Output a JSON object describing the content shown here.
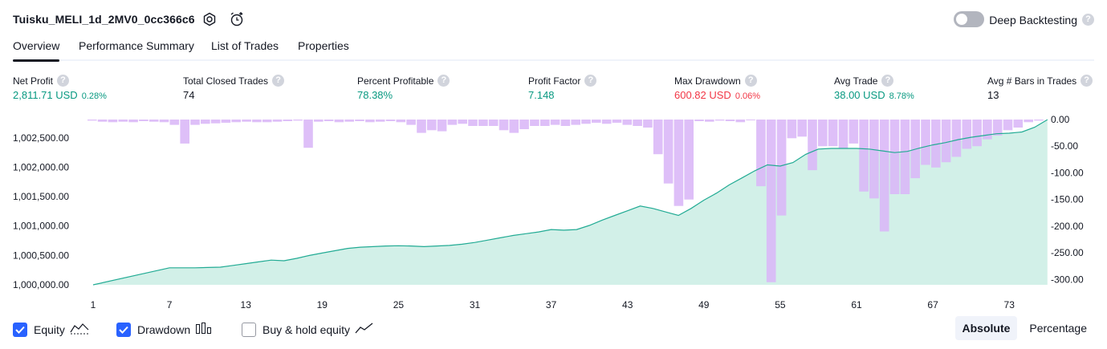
{
  "header": {
    "title": "Tuisku_MELI_1d_2MV0_0cc366c6",
    "deep_backtesting_label": "Deep Backtesting",
    "help_glyph": "?"
  },
  "tabs": [
    "Overview",
    "Performance Summary",
    "List of Trades",
    "Properties"
  ],
  "metrics": [
    {
      "label": "Net Profit",
      "value": "2,811.71 USD",
      "pct": "0.28%",
      "color": "green"
    },
    {
      "label": "Total Closed Trades",
      "value": "74",
      "pct": "",
      "color": "default"
    },
    {
      "label": "Percent Profitable",
      "value": "78.38%",
      "pct": "",
      "color": "green"
    },
    {
      "label": "Profit Factor",
      "value": "7.148",
      "pct": "",
      "color": "green"
    },
    {
      "label": "Max Drawdown",
      "value": "600.82 USD",
      "pct": "0.06%",
      "color": "red"
    },
    {
      "label": "Avg Trade",
      "value": "38.00 USD",
      "pct": "8.78%",
      "color": "green"
    },
    {
      "label": "Avg # Bars in Trades",
      "value": "13",
      "pct": "",
      "color": "default"
    }
  ],
  "chart_data": {
    "type": "bar",
    "left_axis": {
      "ticks": [
        "1,002,500.00",
        "1,002,000.00",
        "1,001,500.00",
        "1,001,000.00",
        "1,000,500.00",
        "1,000,000.00"
      ],
      "values": [
        1002500,
        1002000,
        1001500,
        1001000,
        1000500,
        1000000
      ],
      "range": [
        1000000,
        1002811.71
      ]
    },
    "right_axis": {
      "ticks": [
        "0.00",
        "-50.00",
        "-100.00",
        "-150.00",
        "-200.00",
        "-250.00",
        "-300.00"
      ],
      "values": [
        0,
        -50,
        -100,
        -150,
        -200,
        -250,
        -300
      ],
      "range": [
        -310,
        0
      ]
    },
    "x_ticks": [
      "1",
      "7",
      "13",
      "19",
      "25",
      "31",
      "37",
      "43",
      "49",
      "55",
      "61",
      "67",
      "73"
    ],
    "x_tick_values": [
      1,
      7,
      13,
      19,
      25,
      31,
      37,
      43,
      49,
      55,
      61,
      67,
      73
    ],
    "series": [
      {
        "name": "Equity",
        "type": "area",
        "color": "#22ab94",
        "points": [
          [
            1,
            1000000
          ],
          [
            7,
            1000290
          ],
          [
            8,
            1000290
          ],
          [
            9,
            1000290
          ],
          [
            10,
            1000295
          ],
          [
            11,
            1000300
          ],
          [
            12,
            1000330
          ],
          [
            13,
            1000360
          ],
          [
            14,
            1000390
          ],
          [
            15,
            1000420
          ],
          [
            16,
            1000410
          ],
          [
            17,
            1000450
          ],
          [
            18,
            1000500
          ],
          [
            19,
            1000540
          ],
          [
            20,
            1000580
          ],
          [
            21,
            1000620
          ],
          [
            22,
            1000640
          ],
          [
            23,
            1000650
          ],
          [
            24,
            1000660
          ],
          [
            25,
            1000665
          ],
          [
            26,
            1000660
          ],
          [
            27,
            1000650
          ],
          [
            28,
            1000660
          ],
          [
            29,
            1000670
          ],
          [
            30,
            1000690
          ],
          [
            31,
            1000720
          ],
          [
            32,
            1000760
          ],
          [
            33,
            1000800
          ],
          [
            34,
            1000840
          ],
          [
            35,
            1000870
          ],
          [
            36,
            1000900
          ],
          [
            37,
            1000940
          ],
          [
            38,
            1000930
          ],
          [
            39,
            1000940
          ],
          [
            40,
            1001010
          ],
          [
            41,
            1001100
          ],
          [
            42,
            1001180
          ],
          [
            43,
            1001260
          ],
          [
            44,
            1001340
          ],
          [
            45,
            1001300
          ],
          [
            46,
            1001240
          ],
          [
            47,
            1001180
          ],
          [
            48,
            1001300
          ],
          [
            49,
            1001440
          ],
          [
            50,
            1001560
          ],
          [
            51,
            1001700
          ],
          [
            52,
            1001820
          ],
          [
            53,
            1001940
          ],
          [
            54,
            1002040
          ],
          [
            55,
            1002020
          ],
          [
            56,
            1002080
          ],
          [
            57,
            1002220
          ],
          [
            58,
            1002310
          ],
          [
            59,
            1002320
          ],
          [
            60,
            1002320
          ],
          [
            61,
            1002320
          ],
          [
            62,
            1002310
          ],
          [
            63,
            1002280
          ],
          [
            64,
            1002250
          ],
          [
            65,
            1002270
          ],
          [
            66,
            1002330
          ],
          [
            67,
            1002380
          ],
          [
            68,
            1002420
          ],
          [
            69,
            1002470
          ],
          [
            70,
            1002510
          ],
          [
            71,
            1002540
          ],
          [
            72,
            1002570
          ],
          [
            73,
            1002580
          ],
          [
            74,
            1002600
          ],
          [
            75,
            1002680
          ],
          [
            76,
            1002811
          ]
        ]
      },
      {
        "name": "Drawdown",
        "type": "bar",
        "color": "#d9b6f7",
        "values": [
          2,
          4,
          5,
          4,
          5,
          3,
          4,
          5,
          10,
          45,
          10,
          8,
          7,
          6,
          5,
          4,
          5,
          5,
          4,
          3,
          2,
          53,
          4,
          3,
          5,
          4,
          3,
          5,
          4,
          3,
          5,
          10,
          25,
          20,
          22,
          10,
          8,
          12,
          12,
          12,
          20,
          25,
          18,
          12,
          12,
          10,
          12,
          10,
          8,
          6,
          8,
          6,
          10,
          12,
          15,
          65,
          120,
          162,
          150,
          3,
          4,
          2,
          3,
          5,
          1,
          125,
          305,
          180,
          35,
          32,
          95,
          50,
          50,
          55,
          45,
          135,
          148,
          210,
          140,
          140,
          110,
          85,
          90,
          80,
          70,
          55,
          50,
          37,
          30,
          20,
          15,
          5,
          2
        ]
      }
    ],
    "legend": [
      "Equity",
      "Drawdown",
      "Buy & hold equity"
    ]
  },
  "legend": {
    "equity_label": "Equity",
    "drawdown_label": "Drawdown",
    "buyhold_label": "Buy & hold equity",
    "equity_checked": true,
    "drawdown_checked": true,
    "buyhold_checked": false
  },
  "view_toggle": {
    "absolute_label": "Absolute",
    "percentage_label": "Percentage",
    "active": "Absolute"
  }
}
